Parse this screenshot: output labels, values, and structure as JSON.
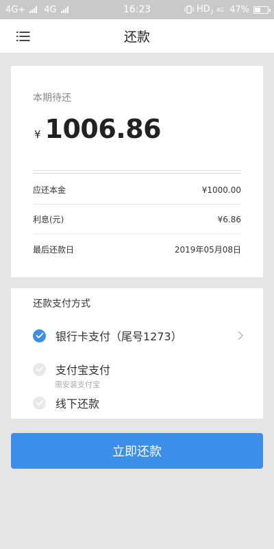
{
  "status_bar": {
    "network_left": "4G+",
    "network_right": "4G",
    "time": "16:23",
    "hd_label": "HD",
    "hd_sub": "2",
    "net_speed": "4G",
    "battery_percent": "47%",
    "battery_level": 0.47
  },
  "header": {
    "title": "还款",
    "menu_icon": "menu-icon"
  },
  "bill": {
    "label": "本期待还",
    "currency": "¥",
    "amount": "1006.86",
    "rows": [
      {
        "label": "应还本金",
        "value": "¥1000.00"
      },
      {
        "label": "利息(元)",
        "value": "¥6.86"
      },
      {
        "label": "最后还款日",
        "value": "2019年05月08日"
      }
    ]
  },
  "payment": {
    "title": "还款支付方式",
    "options": [
      {
        "label": "银行卡支付（尾号1273）",
        "selected": true
      },
      {
        "label": "支付宝支付",
        "sub": "需安装支付宝",
        "selected": false
      },
      {
        "label": "线下还款",
        "selected": false
      }
    ]
  },
  "button": {
    "label": "立即还款"
  },
  "colors": {
    "accent": "#3d8ee8",
    "background": "#e5e5e5"
  }
}
